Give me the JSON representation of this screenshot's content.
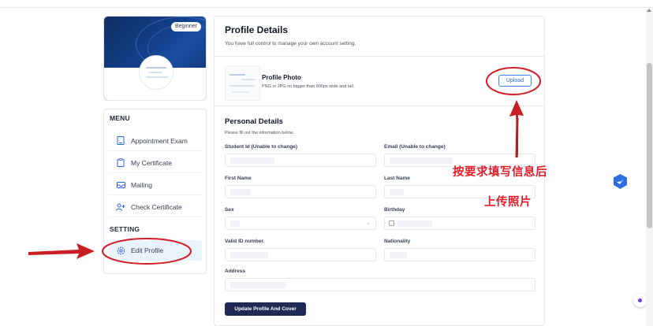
{
  "sidebar": {
    "badge": "Beginner",
    "menu_heading": "MENU",
    "items": [
      {
        "label": "Appointment Exam",
        "icon": "tablet-icon"
      },
      {
        "label": "My Certificate",
        "icon": "clipboard-icon"
      },
      {
        "label": "Mailing",
        "icon": "mail-icon"
      },
      {
        "label": "Check Certificate",
        "icon": "user-plus-icon"
      }
    ],
    "setting_heading": "SETTING",
    "setting_items": [
      {
        "label": "Edit Profile",
        "icon": "gear-icon"
      }
    ]
  },
  "main": {
    "title": "Profile Details",
    "subtitle": "You have full control to manage your own account setting.",
    "photo": {
      "title": "Profile Photo",
      "hint": "PNG or JPG no bigger than 800px wide and tall.",
      "upload_label": "Upload"
    },
    "personal": {
      "title": "Personal Details",
      "subtitle": "Please fill out the information below.",
      "fields": {
        "student_id": "Student Id (Unable to change)",
        "email": "Email (Unable to change)",
        "first_name": "First Name",
        "last_name": "Last Name",
        "sex": "Sex",
        "birthday": "Birthday",
        "valid_id": "Valid ID number.",
        "nationality": "Nationality",
        "address": "Address"
      }
    },
    "submit_label": "Update Profile And Cover"
  },
  "annotations": {
    "line1": "按要求填写信息后",
    "line2": "上传照片",
    "color": "#e11d2a"
  },
  "colors": {
    "accent": "#2563eb",
    "submit_bg": "#1e2a52",
    "active_menu_bg": "#e9f3fb"
  }
}
